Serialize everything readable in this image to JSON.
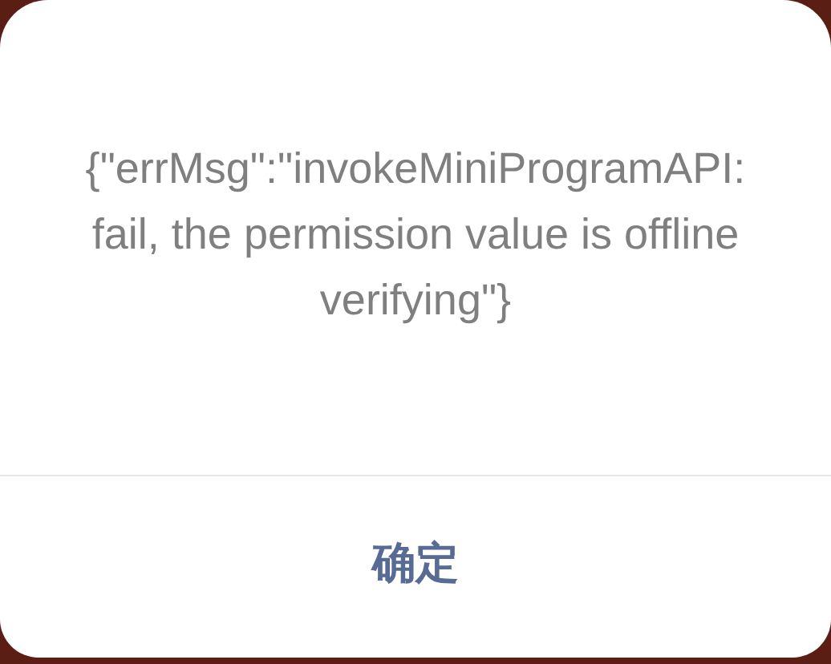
{
  "dialog": {
    "message": "{\"errMsg\":\"invokeMiniProgramAPI:fail, the permission value is offline verifying\"}",
    "buttons": [
      "确定"
    ]
  }
}
